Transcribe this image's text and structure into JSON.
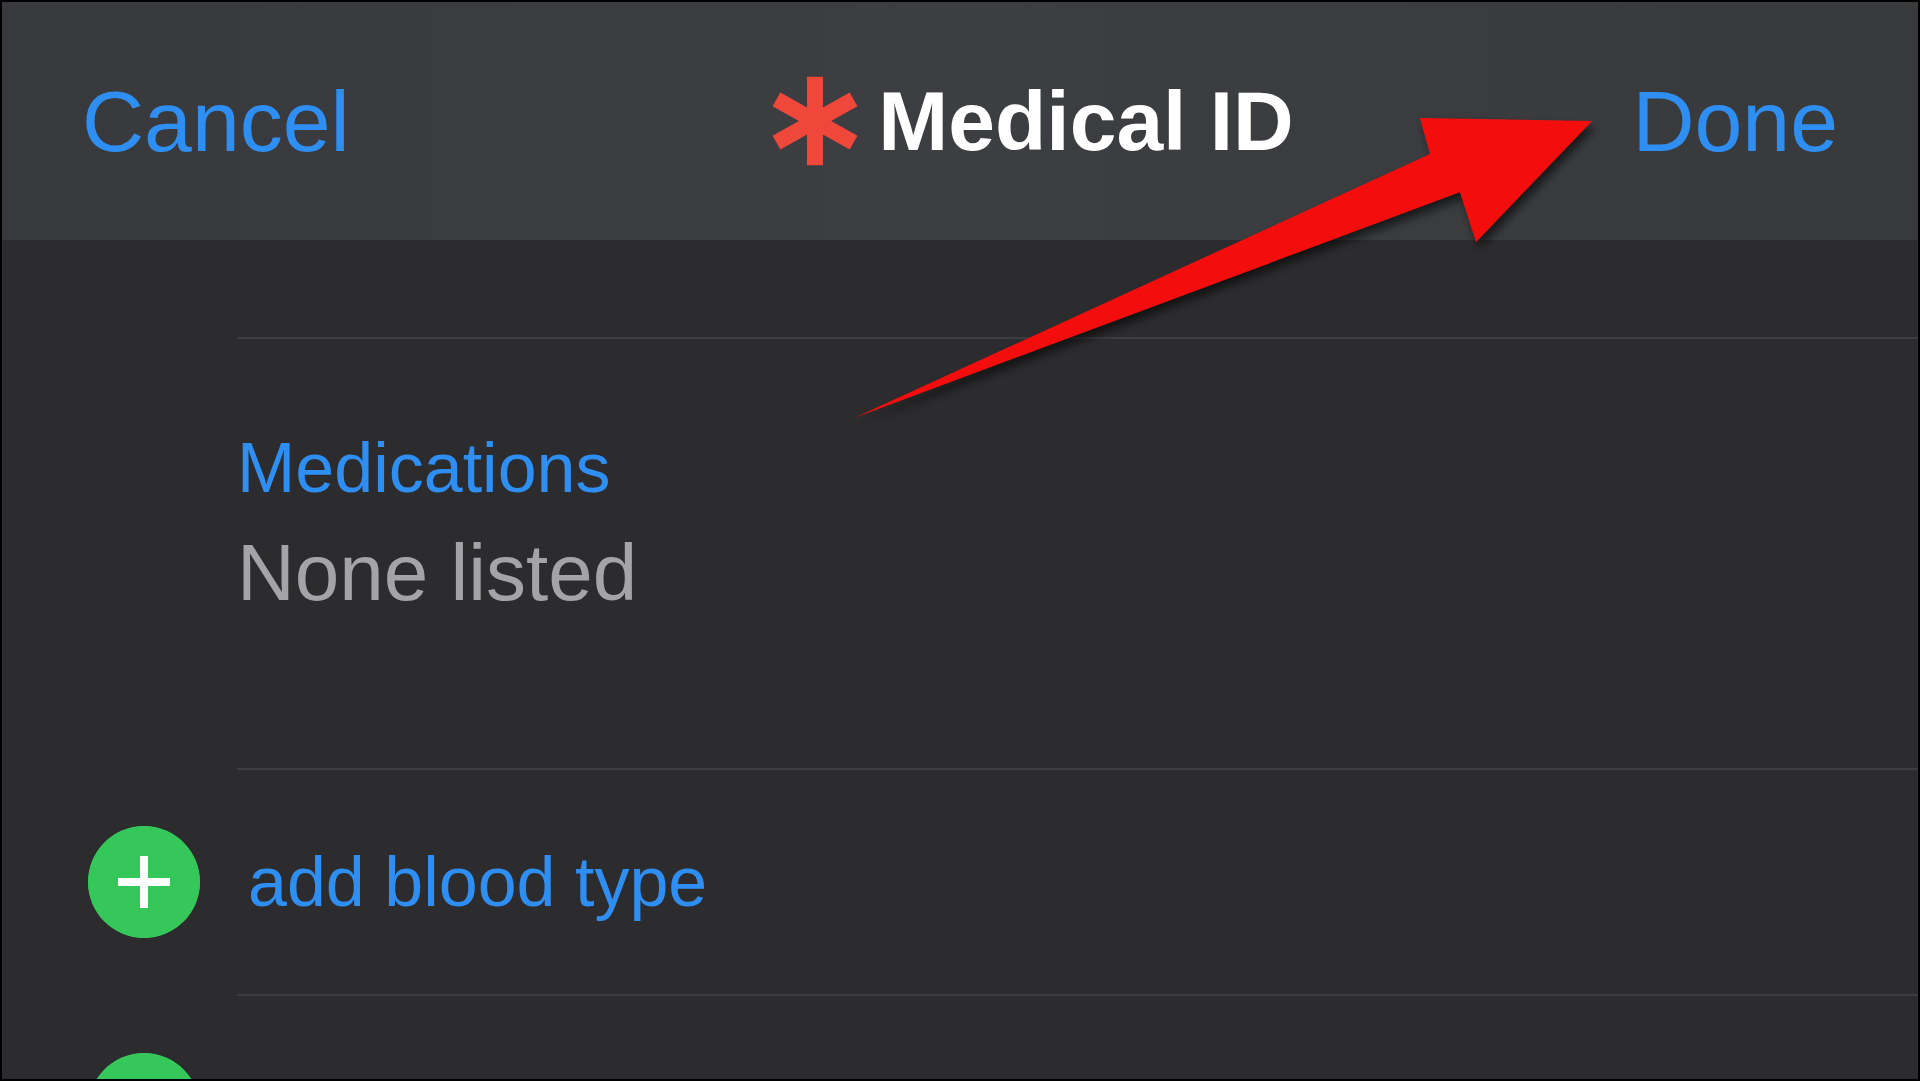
{
  "nav_bar": {
    "cancel": "Cancel",
    "title": "Medical ID",
    "done": "Done"
  },
  "rows": [
    {
      "kind": "field",
      "label": "Medications",
      "value": "None listed"
    },
    {
      "kind": "add",
      "label": "add blood type"
    },
    {
      "kind": "add"
    }
  ]
}
